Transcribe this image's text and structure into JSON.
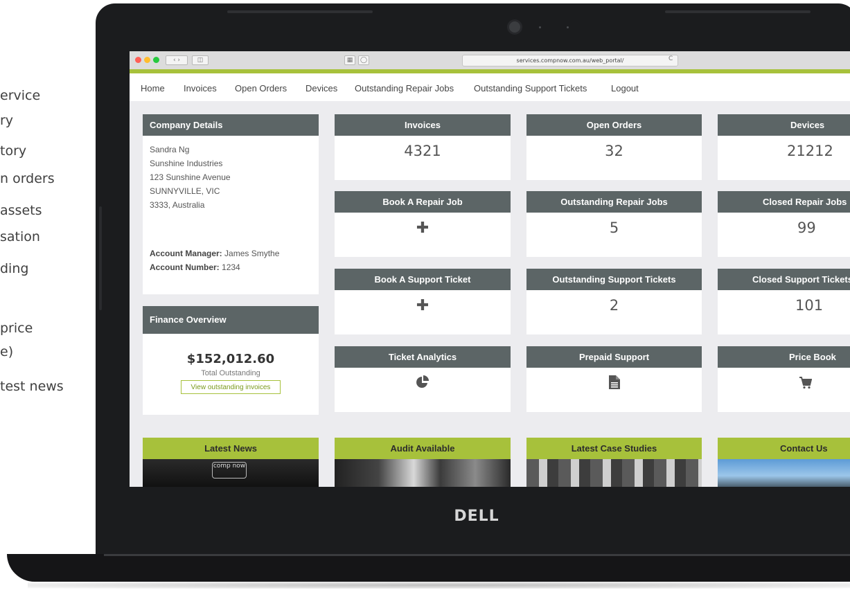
{
  "features": [
    "ervice",
    "ry",
    "tory",
    "n orders",
    "assets",
    "sation",
    "ding",
    "price",
    "e)",
    "test news"
  ],
  "laptop": {
    "brand": "DELL"
  },
  "browser": {
    "url": "services.compnow.com.au/web_portal/",
    "reload": "C"
  },
  "nav": [
    "Home",
    "Invoices",
    "Open Orders",
    "Devices",
    "Outstanding Repair Jobs",
    "Outstanding Support Tickets",
    "Logout"
  ],
  "company": {
    "title": "Company Details",
    "lines": [
      "Sandra Ng",
      "Sunshine Industries",
      "123 Sunshine Avenue",
      "SUNNYVILLE, VIC",
      "3333, Australia"
    ],
    "manager_label": "Account Manager:",
    "manager_value": "James Smythe",
    "number_label": "Account Number:",
    "number_value": "1234"
  },
  "finance": {
    "title": "Finance Overview",
    "amount": "$152,012.60",
    "label": "Total Outstanding",
    "button": "View outstanding invoices"
  },
  "tiles": {
    "invoices": {
      "title": "Invoices",
      "value": "4321"
    },
    "open_orders": {
      "title": "Open Orders",
      "value": "32"
    },
    "devices": {
      "title": "Devices",
      "value": "21212"
    },
    "book_repair": {
      "title": "Book A Repair Job",
      "icon": "plus-icon"
    },
    "outstanding_repair": {
      "title": "Outstanding Repair Jobs",
      "value": "5"
    },
    "closed_repair": {
      "title": "Closed Repair Jobs",
      "value": "99"
    },
    "book_support": {
      "title": "Book A Support Ticket",
      "icon": "plus-icon"
    },
    "outstanding_support": {
      "title": "Outstanding Support Tickets",
      "value": "2"
    },
    "closed_support": {
      "title": "Closed Support Tickets",
      "value": "101"
    },
    "ticket_analytics": {
      "title": "Ticket Analytics",
      "icon": "pie-chart-icon"
    },
    "prepaid_support": {
      "title": "Prepaid Support",
      "icon": "document-icon"
    },
    "price_book": {
      "title": "Price Book",
      "icon": "cart-icon"
    }
  },
  "bottom": {
    "latest_news": "Latest News",
    "news_logo": "comp now",
    "audit": "Audit Available",
    "case_studies": "Latest Case Studies",
    "contact": "Contact Us"
  },
  "colors": {
    "accent": "#a7c13b",
    "header": "#5c6566",
    "bezel": "#1b1c1e",
    "screen_bg": "#ececef"
  }
}
